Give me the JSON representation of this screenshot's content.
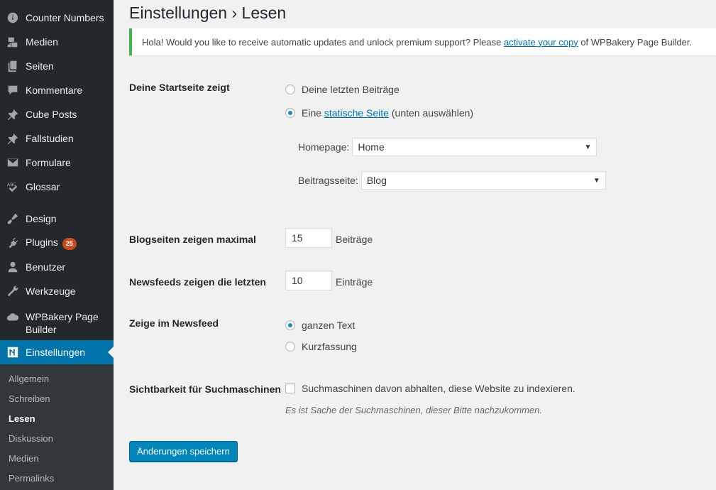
{
  "sidebar": {
    "items": [
      {
        "label": "Counter Numbers",
        "icon": "dashboard-gauge-icon"
      },
      {
        "label": "Medien",
        "icon": "media-icon"
      },
      {
        "label": "Seiten",
        "icon": "pages-icon"
      },
      {
        "label": "Kommentare",
        "icon": "comment-icon"
      },
      {
        "label": "Cube Posts",
        "icon": "pin-icon"
      },
      {
        "label": "Fallstudien",
        "icon": "pin-icon"
      },
      {
        "label": "Formulare",
        "icon": "envelope-icon"
      },
      {
        "label": "Glossar",
        "icon": "spellcheck-icon"
      },
      {
        "label": "Design",
        "icon": "paintbrush-icon"
      },
      {
        "label": "Plugins",
        "icon": "plugin-icon",
        "badge": "25"
      },
      {
        "label": "Benutzer",
        "icon": "user-icon"
      },
      {
        "label": "Werkzeuge",
        "icon": "wrench-icon"
      },
      {
        "label": "WPBakery Page Builder",
        "icon": "cloud-icon"
      },
      {
        "label": "Einstellungen",
        "icon": "settings-icon"
      }
    ],
    "submenu": [
      "Allgemein",
      "Schreiben",
      "Lesen",
      "Diskussion",
      "Medien",
      "Permalinks"
    ],
    "current_submenu": "Lesen"
  },
  "page": {
    "title": "Einstellungen › Lesen"
  },
  "notice": {
    "text_before": "Hola! Would you like to receive automatic updates and unlock premium support? Please ",
    "link": "activate your copy",
    "text_after": " of WPBakery Page Builder.",
    "accent_color": "#46b450"
  },
  "front_page": {
    "label": "Deine Startseite zeigt",
    "option_latest": "Deine letzten Beiträge",
    "option_static_prefix": "Eine ",
    "option_static_link": "statische Seite",
    "option_static_suffix": " (unten auswählen)",
    "selected": "static",
    "homepage_label": "Homepage:",
    "homepage_value": "Home",
    "posts_page_label": "Beitragsseite:",
    "posts_page_value": "Blog"
  },
  "posts_per_page": {
    "label": "Blogseiten zeigen maximal",
    "value": "15",
    "unit": "Beiträge"
  },
  "feeds": {
    "label": "Newsfeeds zeigen die letzten",
    "value": "10",
    "unit": "Einträge"
  },
  "feed_content": {
    "label": "Zeige im Newsfeed",
    "option_full": "ganzen Text",
    "option_summary": "Kurzfassung",
    "selected": "full"
  },
  "search_visibility": {
    "label": "Sichtbarkeit für Suchmaschinen",
    "checkbox_label": "Suchmaschinen davon abhalten, diese Website zu indexieren.",
    "checked": false,
    "description": "Es ist Sache der Suchmaschinen, dieser Bitte nachzukommen."
  },
  "save_button": "Änderungen speichern",
  "colors": {
    "sidebar_bg": "#23282d",
    "submenu_bg": "#32373c",
    "active_bg": "#0073aa",
    "badge": "#ca4a1f",
    "primary_button": "#0085ba",
    "link": "#0073aa"
  }
}
